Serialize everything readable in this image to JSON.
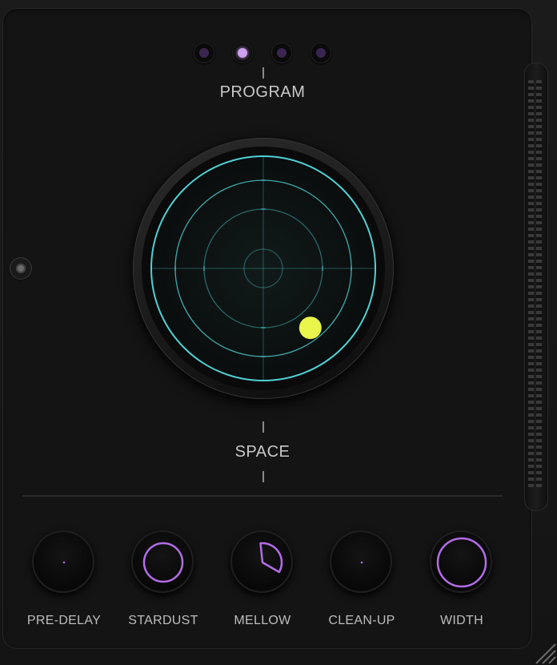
{
  "program": {
    "label": "PROGRAM",
    "slots": [
      {
        "id": 1,
        "active": false
      },
      {
        "id": 2,
        "active": true
      },
      {
        "id": 3,
        "active": false
      },
      {
        "id": 4,
        "active": false
      }
    ],
    "colors": {
      "active": "#cfa0ee",
      "inactive": "#3a2550"
    }
  },
  "space": {
    "label": "SPACE",
    "puck": {
      "x": 0.42,
      "y": -0.53
    },
    "colors": {
      "grid": "#4fd1d4",
      "puck": "#e9f54a"
    }
  },
  "knobs": [
    {
      "name": "pre-delay",
      "label": "PRE-DELAY",
      "value": 0.0
    },
    {
      "name": "stardust",
      "label": "STARDUST",
      "value": 1.0
    },
    {
      "name": "mellow",
      "label": "MELLOW",
      "value": 0.35
    },
    {
      "name": "clean-up",
      "label": "CLEAN-UP",
      "value": 0.0
    },
    {
      "name": "width",
      "label": "WIDTH",
      "value": 1.0
    }
  ],
  "accent_color": "#b26ce8",
  "icons": {
    "side_toggle": "radio-dot-icon",
    "resize": "resize-grip-icon",
    "meter": "level-meter-icon"
  }
}
